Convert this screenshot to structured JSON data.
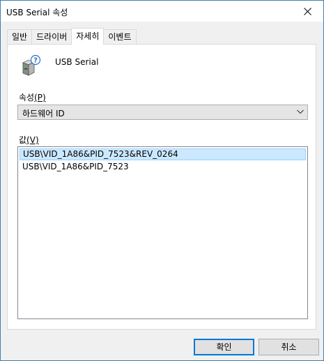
{
  "window": {
    "title": "USB Serial 속성"
  },
  "tabs": [
    {
      "label": "일반"
    },
    {
      "label": "드라이버"
    },
    {
      "label": "자세히"
    },
    {
      "label": "이벤트"
    }
  ],
  "active_tab_index": 2,
  "device": {
    "name": "USB Serial",
    "icon": "usb-device-question-icon"
  },
  "property": {
    "label": "속성",
    "access_key": "(P)",
    "selected": "하드웨어 ID"
  },
  "value": {
    "label": "값",
    "access_key": "(V)",
    "items": [
      "USB\\VID_1A86&PID_7523&REV_0264",
      "USB\\VID_1A86&PID_7523"
    ],
    "selected_index": 0
  },
  "buttons": {
    "ok": "확인",
    "cancel": "취소"
  },
  "colors": {
    "selection_bg": "#cce8ff",
    "selection_border": "#99d1ff",
    "default_button_border": "#0078d7"
  }
}
